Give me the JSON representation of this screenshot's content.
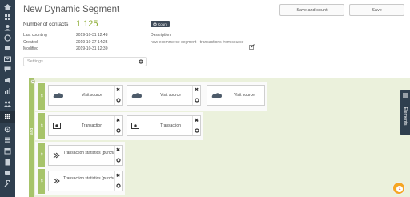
{
  "page": {
    "title": "New Dynamic Segment",
    "save_and_count_label": "Save and count",
    "save_label": "Save"
  },
  "summary": {
    "contacts_label": "Number of contacts",
    "contacts_value": "1 125",
    "count_button_label": "Count",
    "last_counting_label": "Last counting",
    "last_counting_value": "2019-10-31 12:48",
    "created_label": "Created",
    "created_value": "2019-10-27 14:25",
    "modified_label": "Modified",
    "modified_value": "2019-10-31 12:30",
    "description_label": "Description",
    "description_value": "new ecommerce segment - transactions from source"
  },
  "settings": {
    "placeholder": "Settings"
  },
  "segment_builder": {
    "and_label": "and",
    "or_label": "or",
    "add_marker": "+",
    "elements_tab_label": "Elements",
    "rows": [
      {
        "cards": [
          "Visit source",
          "Visit source",
          "Visit source"
        ]
      },
      {
        "cards": [
          "Transaction",
          "Transaction"
        ]
      },
      {
        "cards": [
          "Transaction statistics (purchase)"
        ]
      },
      {
        "cards": [
          "Transaction statistics (purchase)"
        ]
      }
    ],
    "remove_glyph": "✖"
  },
  "user": {
    "notification_count": "1"
  },
  "colors": {
    "sidebar": "#2f3f4f",
    "accent_green": "#8dac35",
    "builder_bg": "#ebf1dc",
    "connector_green": "#a7c46a"
  },
  "icons": {
    "sidebar": [
      "home-icon",
      "dashboard-icon",
      "contacts-icon",
      "segments-icon",
      "campaigns-icon",
      "email-icon",
      "chat-icon",
      "megaphone-icon",
      "analytics-icon",
      "users-icon",
      "settings-icon",
      "grid-icon",
      "calendar-icon",
      "list-icon",
      "reports-icon",
      "help-icon",
      "tools-icon"
    ],
    "card_types": [
      "visit-source-cloud-icon",
      "transaction-icon",
      "transaction-statistics-icon"
    ]
  }
}
